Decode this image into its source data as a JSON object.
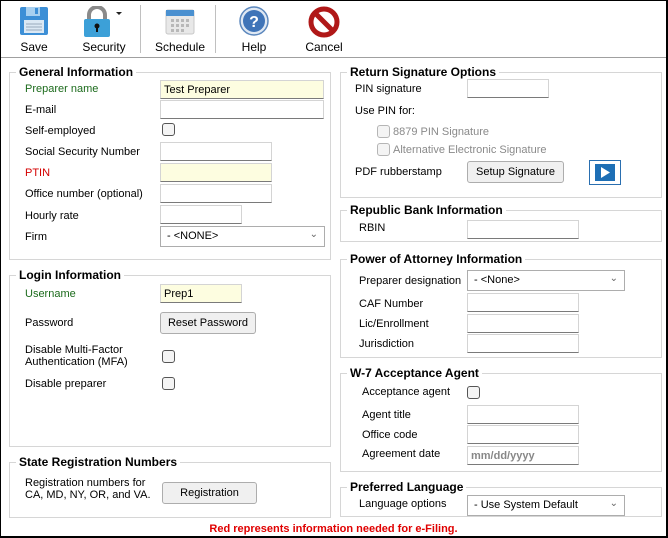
{
  "toolbar": {
    "save": "Save",
    "security": "Security",
    "schedule": "Schedule",
    "help": "Help",
    "cancel": "Cancel"
  },
  "general": {
    "title": "General Information",
    "preparer_name_label": "Preparer name",
    "preparer_name_value": "Test Preparer",
    "email_label": "E-mail",
    "email_value": "",
    "self_employed_label": "Self-employed",
    "self_employed_checked": false,
    "ssn_label": "Social Security Number",
    "ssn_value": "",
    "ptin_label": "PTIN",
    "ptin_value": "",
    "office_label": "Office number (optional)",
    "office_value": "",
    "hourly_label": "Hourly rate",
    "hourly_value": "",
    "firm_label": "Firm",
    "firm_value": "- <NONE>"
  },
  "login": {
    "title": "Login Information",
    "username_label": "Username",
    "username_value": "Prep1",
    "password_label": "Password",
    "reset_password": "Reset Password",
    "mfa_label_1": "Disable Multi-Factor",
    "mfa_label_2": "Authentication (MFA)",
    "mfa_checked": false,
    "disable_label": "Disable preparer",
    "disable_checked": false
  },
  "state": {
    "title": "State Registration Numbers",
    "desc_1": "Registration numbers for",
    "desc_2": "CA, MD, NY, OR, and VA.",
    "button": "Registration"
  },
  "signature": {
    "title": "Return Signature Options",
    "pin_label": "PIN signature",
    "pin_value": "",
    "use_pin_label": "Use PIN for:",
    "opt_8879": "8879 PIN Signature",
    "opt_alt": "Alternative Electronic Signature",
    "pdf_label": "PDF rubberstamp",
    "setup_button": "Setup Signature"
  },
  "bank": {
    "title": "Republic Bank Information",
    "rbin_label": "RBIN",
    "rbin_value": ""
  },
  "poa": {
    "title": "Power of Attorney Information",
    "designation_label": "Preparer designation",
    "designation_value": "- <None>",
    "caf_label": "CAF Number",
    "lic_label": "Lic/Enrollment",
    "jurisdiction_label": "Jurisdiction"
  },
  "w7": {
    "title": "W-7 Acceptance Agent",
    "agent_label": "Acceptance agent",
    "agent_checked": false,
    "title_label": "Agent title",
    "office_label": "Office code",
    "date_label": "Agreement date",
    "date_placeholder": "mm/dd/yyyy"
  },
  "language": {
    "title": "Preferred Language",
    "options_label": "Language options",
    "options_value": "- Use System Default"
  },
  "footer": "Red represents information needed for e-Filing."
}
